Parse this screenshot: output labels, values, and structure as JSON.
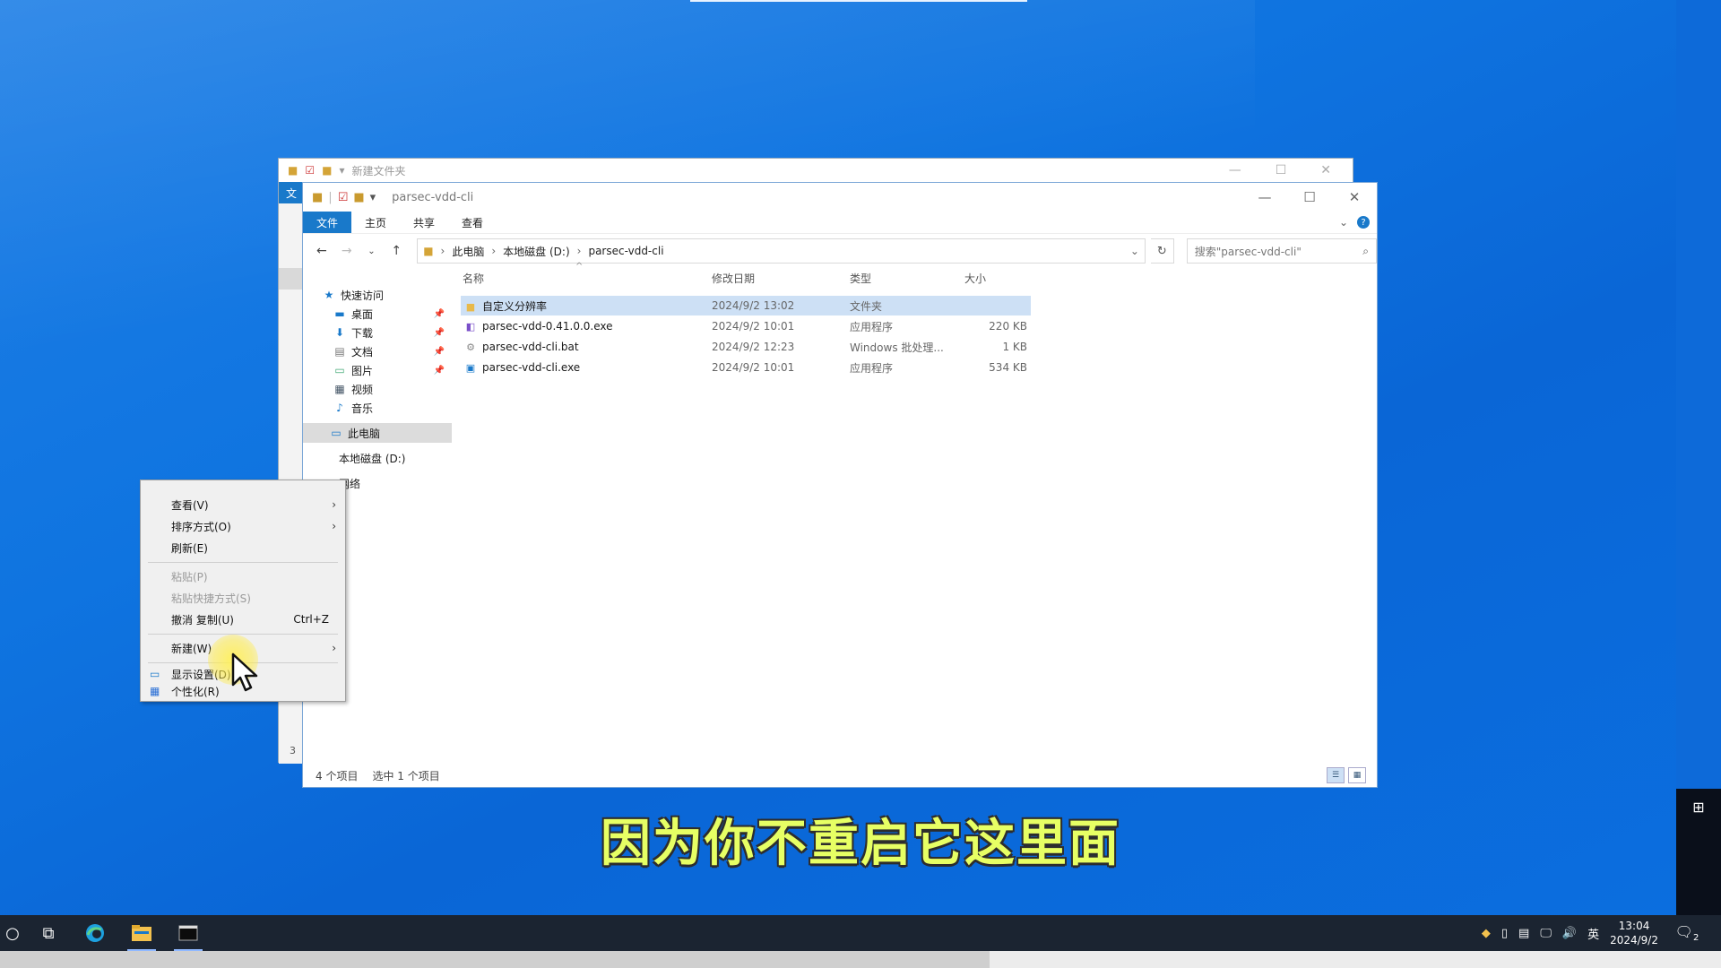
{
  "back_window": {
    "title": "新建文件夹",
    "left_tab": "文",
    "status_count": "3"
  },
  "window": {
    "title": "parsec-vdd-cli",
    "ribbon_tabs": [
      "文件",
      "主页",
      "共享",
      "查看"
    ],
    "help": "?",
    "address": [
      "此电脑",
      "本地磁盘 (D:)",
      "parsec-vdd-cli"
    ],
    "search_placeholder": "搜索\"parsec-vdd-cli\""
  },
  "nav": {
    "quick_access": "快速访问",
    "items": [
      {
        "label": "桌面",
        "pinned": true
      },
      {
        "label": "下载",
        "pinned": true
      },
      {
        "label": "文档",
        "pinned": true
      },
      {
        "label": "图片",
        "pinned": true
      },
      {
        "label": "视频",
        "pinned": false
      },
      {
        "label": "音乐",
        "pinned": false
      }
    ],
    "this_pc": "此电脑",
    "local_disk": "本地磁盘 (D:)",
    "network": "网络"
  },
  "columns": {
    "name": "名称",
    "modified": "修改日期",
    "type": "类型",
    "size": "大小"
  },
  "files": [
    {
      "name": "自定义分辨率",
      "modified": "2024/9/2 13:02",
      "type": "文件夹",
      "size": ""
    },
    {
      "name": "parsec-vdd-0.41.0.0.exe",
      "modified": "2024/9/2 10:01",
      "type": "应用程序",
      "size": "220 KB"
    },
    {
      "name": "parsec-vdd-cli.bat",
      "modified": "2024/9/2 12:23",
      "type": "Windows 批处理...",
      "size": "1 KB"
    },
    {
      "name": "parsec-vdd-cli.exe",
      "modified": "2024/9/2 10:01",
      "type": "应用程序",
      "size": "534 KB"
    }
  ],
  "status": {
    "count": "4 个项目",
    "selected": "选中 1 个项目"
  },
  "context_menu": {
    "view": "查看(V)",
    "sort": "排序方式(O)",
    "refresh": "刷新(E)",
    "paste": "粘贴(P)",
    "paste_shortcut": "粘贴快捷方式(S)",
    "undo": "撤消 复制(U)",
    "undo_shortcut": "Ctrl+Z",
    "new": "新建(W)",
    "display": "显示设置(D)",
    "personalize": "个性化(R)"
  },
  "subtitle": "因为你不重启它这里面",
  "taskbar": {
    "ime": "英",
    "time": "13:04",
    "date": "2024/9/2",
    "notification_count": "2"
  },
  "video_progress": 0.575
}
